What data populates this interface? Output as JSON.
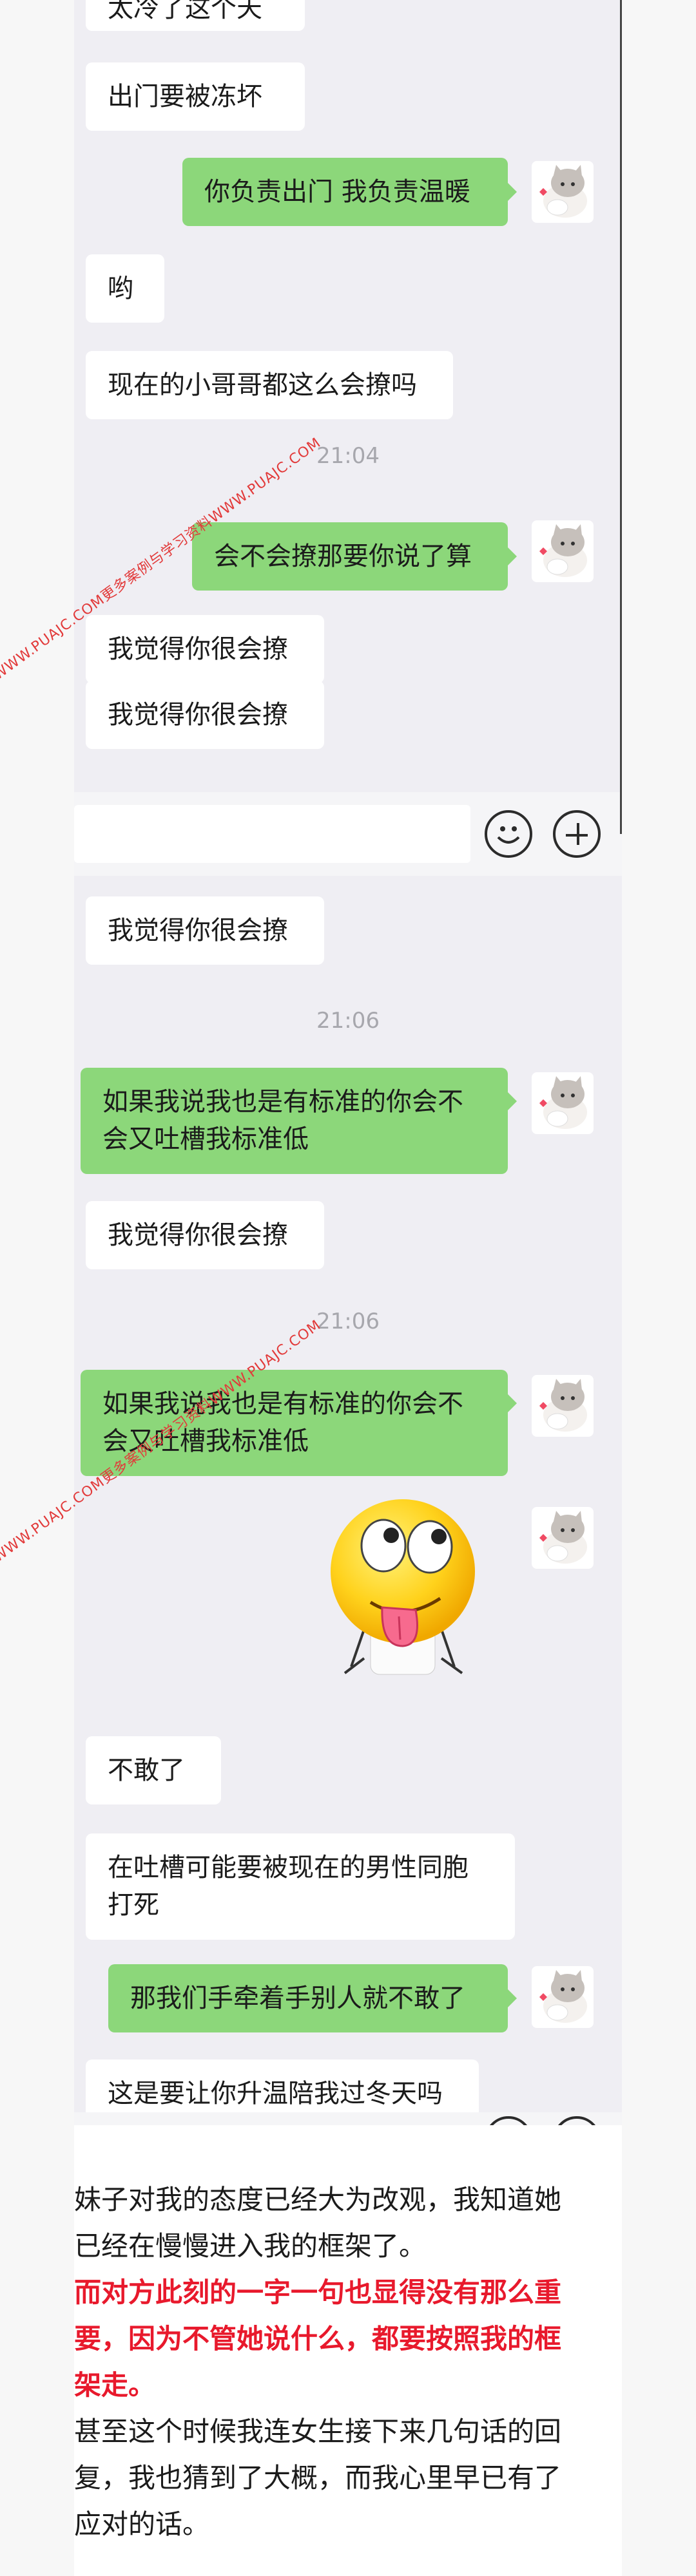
{
  "chat1": {
    "messages": [
      {
        "side": "in",
        "text": "太冷了这个天"
      },
      {
        "side": "in",
        "text": "出门要被冻坏"
      },
      {
        "side": "out",
        "text": "你负责出门 我负责温暖"
      },
      {
        "side": "in",
        "text": "哟"
      },
      {
        "side": "in",
        "text": "现在的小哥哥都这么会撩吗"
      },
      {
        "side": "out",
        "text": "会不会撩那要你说了算"
      },
      {
        "side": "in",
        "text": "我觉得你很会撩"
      },
      {
        "side": "in",
        "text": "我觉得你很会撩"
      }
    ],
    "timestamp": "21:04"
  },
  "chat2": {
    "messages": [
      {
        "side": "in",
        "text": "我觉得你很会撩"
      },
      {
        "side": "out",
        "text": "如果我说我也是有标准的你会不会又吐槽我标准低",
        "line1": "如果我说我也是有标准的你会不",
        "line2": "会又吐槽我标准低"
      },
      {
        "side": "in",
        "text": "我觉得你很会撩"
      },
      {
        "side": "out",
        "text": "如果我说我也是有标准的你会不会又吐槽我标准低",
        "line1": "如果我说我也是有标准的你会不",
        "line2": "会又吐槽我标准低"
      },
      {
        "side": "out",
        "sticker": "tongue-out-emoji"
      },
      {
        "side": "in",
        "text": "不敢了"
      },
      {
        "side": "in",
        "text": "在吐槽可能要被现在的男性同胞打死",
        "line1": "在吐槽可能要被现在的男性同胞",
        "line2": "打死"
      },
      {
        "side": "out",
        "text": "那我们手牵着手别人就不敢了"
      },
      {
        "side": "in",
        "text": "这是要让你升温陪我过冬天吗"
      }
    ],
    "timestamps": [
      "21:06",
      "21:06"
    ]
  },
  "watermark": "WWW.PUAJC.COM更多案例与学习资料WWW.PUAJC.COM",
  "caption": {
    "p1": "妹子对我的态度已经大为改观，我知道她已经在慢慢进入我的框架了。",
    "p1_l1": "妹子对我的态度已经大为改观，我知道她",
    "p1_l2": "已经在慢慢进入我的框架了。",
    "p2_l1": "而对方此刻的一字一句也显得没有那么重",
    "p2_l2": "要，因为不管她说什么，都要按照我的框",
    "p2_l3": "架走。",
    "p3_l1": "甚至这个时候我连女生接下来几句话的回",
    "p3_l2": "复，我也猜到了大概，而我心里早已有了",
    "p3_l3": "应对的话。"
  },
  "colors": {
    "outgoing": "#8cd77a",
    "incoming": "#ffffff",
    "chat_bg": "#efeef3",
    "emphasis": "#e8192c"
  },
  "icons": [
    "emoji-icon",
    "plus-icon",
    "avatar-cat-icon"
  ]
}
